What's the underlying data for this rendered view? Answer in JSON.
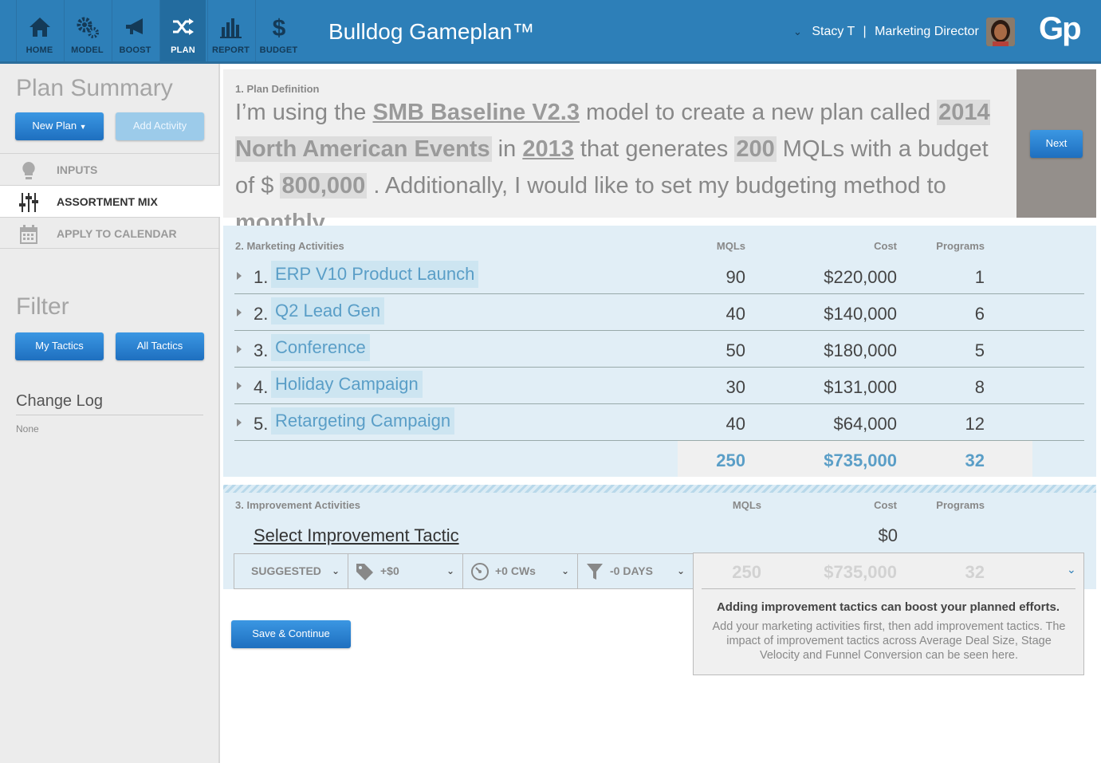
{
  "app": {
    "title": "Bulldog Gameplan™",
    "logo": "Gp"
  },
  "nav": [
    {
      "label": "HOME",
      "icon": "home-icon"
    },
    {
      "label": "MODEL",
      "icon": "gears-icon"
    },
    {
      "label": "BOOST",
      "icon": "megaphone-icon"
    },
    {
      "label": "PLAN",
      "icon": "shuffle-icon",
      "active": true
    },
    {
      "label": "REPORT",
      "icon": "bar-chart-icon"
    },
    {
      "label": "BUDGET",
      "icon": "dollar-icon"
    }
  ],
  "user": {
    "name": "Stacy T",
    "separator": "|",
    "role": "Marketing Director"
  },
  "sidebar": {
    "summary_title": "Plan Summary",
    "new_plan": "New Plan",
    "add_activity": "Add Activity",
    "menu": [
      {
        "label": "INPUTS",
        "icon": "lightbulb-icon"
      },
      {
        "label": "ASSORTMENT MIX",
        "icon": "sliders-icon",
        "active": true
      },
      {
        "label": "APPLY TO CALENDAR",
        "icon": "calendar-icon"
      }
    ],
    "filter_title": "Filter",
    "my_tactics": "My Tactics",
    "all_tactics": "All Tactics",
    "changelog_title": "Change Log",
    "changelog_value": "None"
  },
  "plan_definition": {
    "label": "1. Plan Definition",
    "t1": "I’m using the ",
    "model": "SMB Baseline V2.3",
    "t2": " model to create a new plan called ",
    "plan_name": "2014 North American Events",
    "t3": "  in ",
    "year": "2013",
    "t4": " that generates ",
    "mqls": "200",
    "t5": " MQLs with a budget of $ ",
    "budget": "800,000",
    "t6": " . Additionally, I would like to set my budgeting method to ",
    "method": "monthly",
    "t7": ".",
    "next": "Next"
  },
  "activities": {
    "label": "2. Marketing Activities",
    "headers": {
      "mqls": "MQLs",
      "cost": "Cost",
      "programs": "Programs"
    },
    "rows": [
      {
        "num": "1.",
        "name": "ERP V10 Product Launch",
        "mqls": "90",
        "cost": "$220,000",
        "programs": "1"
      },
      {
        "num": "2.",
        "name": "Q2 Lead Gen",
        "mqls": "40",
        "cost": "$140,000",
        "programs": "6"
      },
      {
        "num": "3.",
        "name": "Conference",
        "mqls": "50",
        "cost": "$180,000",
        "programs": "5"
      },
      {
        "num": "4.",
        "name": "Holiday Campaign",
        "mqls": "30",
        "cost": "$131,000",
        "programs": "8"
      },
      {
        "num": "5.",
        "name": "Retargeting Campaign",
        "mqls": "40",
        "cost": "$64,000",
        "programs": "12"
      }
    ],
    "totals": {
      "mqls": "250",
      "cost": "$735,000",
      "programs": "32"
    }
  },
  "improvement": {
    "label": "3. Improvement Activities",
    "headers": {
      "mqls": "MQLs",
      "cost": "Cost",
      "programs": "Programs"
    },
    "select_label": "Select Improvement Tactic",
    "cost": "$0",
    "filters": [
      {
        "label": "SUGGESTED"
      },
      {
        "label": "+$0",
        "icon": "tag-icon"
      },
      {
        "label": "+0 CWs",
        "icon": "speedometer-icon"
      },
      {
        "label": "-0 DAYS",
        "icon": "funnel-icon"
      }
    ],
    "ghost": {
      "mqls": "250",
      "cost": "$735,000",
      "programs": "32"
    },
    "popup_title": "Adding improvement tactics can boost your planned efforts.",
    "popup_body": "Add your marketing activities first, then add improvement tactics. The impact of improvement tactics across Average Deal Size, Stage Velocity and Funnel Conversion can be seen here.",
    "save": "Save & Continue"
  }
}
